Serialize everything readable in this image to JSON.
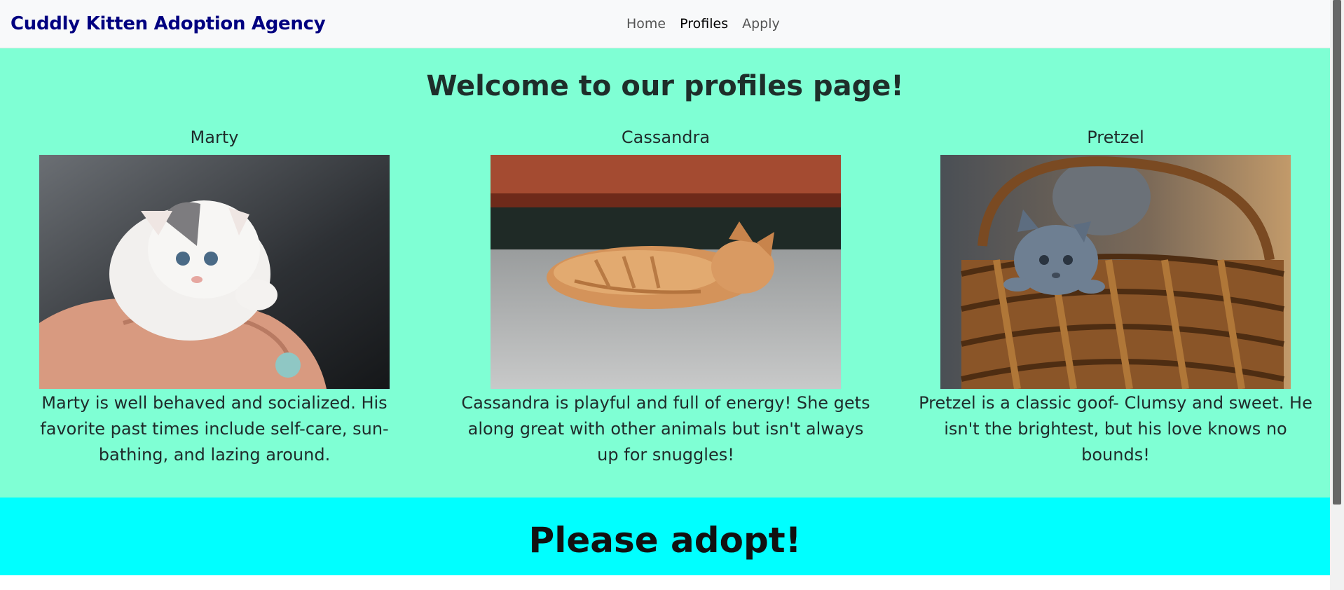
{
  "navbar": {
    "brand": "Cuddly Kitten Adoption Agency",
    "links": [
      {
        "label": "Home",
        "active": false
      },
      {
        "label": "Profiles",
        "active": true
      },
      {
        "label": "Apply",
        "active": false
      }
    ]
  },
  "profiles": {
    "heading": "Welcome to our profiles page!",
    "cards": [
      {
        "name": "Marty",
        "description": "Marty is well behaved and socialized. His favorite past times include self-care, sun-bathing, and lazing around.",
        "photo_icon": "kitten-on-hand-photo"
      },
      {
        "name": "Cassandra",
        "description": "Cassandra is playful and full of energy! She gets along great with other animals but isn't always up for snuggles!",
        "photo_icon": "sleeping-orange-kitten-photo"
      },
      {
        "name": "Pretzel",
        "description": "Pretzel is a classic goof- Clumsy and sweet. He isn't the brightest, but his love knows no bounds!",
        "photo_icon": "grey-kitten-in-basket-photo"
      }
    ]
  },
  "adopt": {
    "heading": "Please adopt!"
  },
  "colors": {
    "page_bg": "#7fffd4",
    "banner_bg": "#00ffff",
    "brand": "#000080",
    "navbar_bg": "#f8f9fa"
  }
}
